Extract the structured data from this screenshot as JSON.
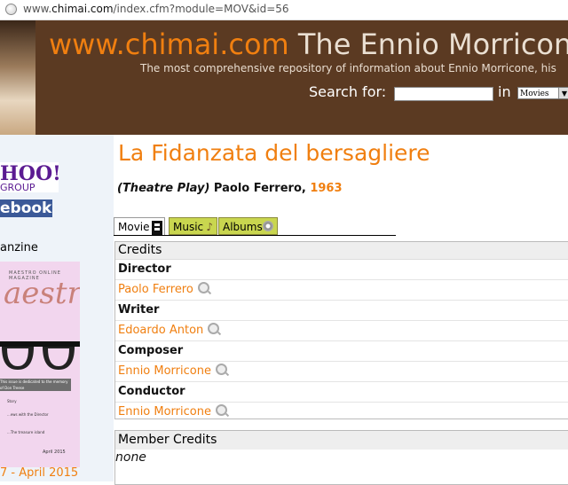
{
  "browser": {
    "url_prefix": "www.",
    "url_domain": "chimai.com",
    "url_path": "/index.cfm?module=MOV&id=56"
  },
  "header": {
    "site_domain": "www.chimai.com",
    "site_title": " The Ennio Morricone",
    "tagline": "The most comprehensive repository of information about Ennio Morricone, his",
    "search_label": "Search for:",
    "search_value": "",
    "in_label": "in",
    "search_scope": "Movies"
  },
  "sidebar": {
    "yahoo_logo": "HOO!",
    "yahoo_group": "GROUP",
    "facebook_logo": "ebook",
    "magazine_label": "anzine",
    "cover": {
      "mini": "MAESTRO ONLINE MAGAZINE",
      "script": "aestro",
      "band": "This issue is dedicated to the memory of Don Treese",
      "line1": "Story",
      "line2": "...ews with the Director",
      "line3": "...The treasure island",
      "date": "April 2015"
    },
    "issue_label": "7 - April 2015"
  },
  "main": {
    "title": "La Fidanzata del bersagliere",
    "type": "(Theatre Play)",
    "author": " Paolo Ferrero, ",
    "year": "1963",
    "tabs": [
      "Movie",
      "Music",
      "Albums"
    ],
    "credits_header": "Credits",
    "credits": [
      {
        "role": "Director",
        "name": "Paolo Ferrero"
      },
      {
        "role": "Writer",
        "name": "Edoardo Anton"
      },
      {
        "role": "Composer",
        "name": "Ennio Morricone"
      },
      {
        "role": "Conductor",
        "name": "Ennio Morricone"
      }
    ],
    "member_credits_header": "Member Credits",
    "member_credits_value": "none"
  },
  "colors": {
    "accent": "#f07f10",
    "header_bg": "#5b3a22",
    "tab_green": "#c9d64f"
  }
}
